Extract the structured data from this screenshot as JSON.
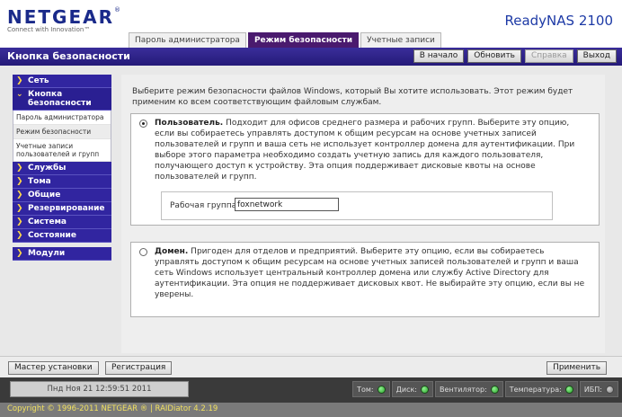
{
  "header": {
    "brand": "NETGEAR",
    "brand_mark": "®",
    "tagline": "Connect with Innovation™",
    "product": "ReadyNAS 2100"
  },
  "tabs": [
    {
      "label": "Пароль администратора",
      "active": false
    },
    {
      "label": "Режим безопасности",
      "active": true
    },
    {
      "label": "Учетные записи",
      "active": false
    }
  ],
  "titlebar": {
    "title": "Кнопка безопасности",
    "buttons": {
      "home": "В начало",
      "refresh": "Обновить",
      "help": "Справка",
      "logout": "Выход"
    }
  },
  "sidebar": {
    "items": [
      {
        "label": "Сеть"
      },
      {
        "label": "Кнопка безопасности",
        "sub": [
          "Пароль администратора",
          "Режим безопасности",
          "Учетные записи пользователей и групп"
        ]
      },
      {
        "label": "Службы"
      },
      {
        "label": "Тома"
      },
      {
        "label": "Общие"
      },
      {
        "label": "Резервирование"
      },
      {
        "label": "Система"
      },
      {
        "label": "Состояние"
      },
      {
        "label": "Модули"
      }
    ]
  },
  "content": {
    "intro": "Выберите режим безопасности файлов Windows, который Вы хотите использовать. Этот режим будет применим ко всем соответствующим файловым службам.",
    "option_user": {
      "title": "Пользователь.",
      "text": "Подходит для офисов среднего размера и рабочих групп. Выберите эту опцию, если вы собираетесь управлять доступом к общим ресурсам на основе учетных записей пользователей и групп и ваша сеть не использует контроллер домена для аутентификации. При выборе этого параметра необходимо создать учетную запись для каждого пользователя, получающего доступ к устройству. Эта опция поддерживает дисковые квоты на основе пользователей и групп.",
      "checked": true
    },
    "workgroup": {
      "label": "Рабочая группа:",
      "value": "foxnetwork"
    },
    "option_domain": {
      "title": "Домен.",
      "text": "Пригоден для отделов и предприятий. Выберите эту опцию, если вы собираетесь управлять доступом к общим ресурсам на основе учетных записей пользователей и групп и ваша сеть Windows использует центральный контроллер домена или службу Active Directory для аутентификации. Эта опция не поддерживает дисковых квот. Не выбирайте эту опцию, если вы не уверены.",
      "checked": false
    }
  },
  "bottom": {
    "setup_wizard": "Мастер установки",
    "registration": "Регистрация",
    "apply": "Применить"
  },
  "status": {
    "datetime": "Пнд Ноя 21  12:59:51 2011",
    "indicators": [
      {
        "label": "Том:",
        "state": "green"
      },
      {
        "label": "Диск:",
        "state": "green"
      },
      {
        "label": "Вентилятор:",
        "state": "green"
      },
      {
        "label": "Температура:",
        "state": "green"
      },
      {
        "label": "ИБП:",
        "state": "gray"
      }
    ]
  },
  "footer": {
    "copyright": "Copyright © 1996-2011 NETGEAR ® | RAIDiator 4.2.19"
  }
}
